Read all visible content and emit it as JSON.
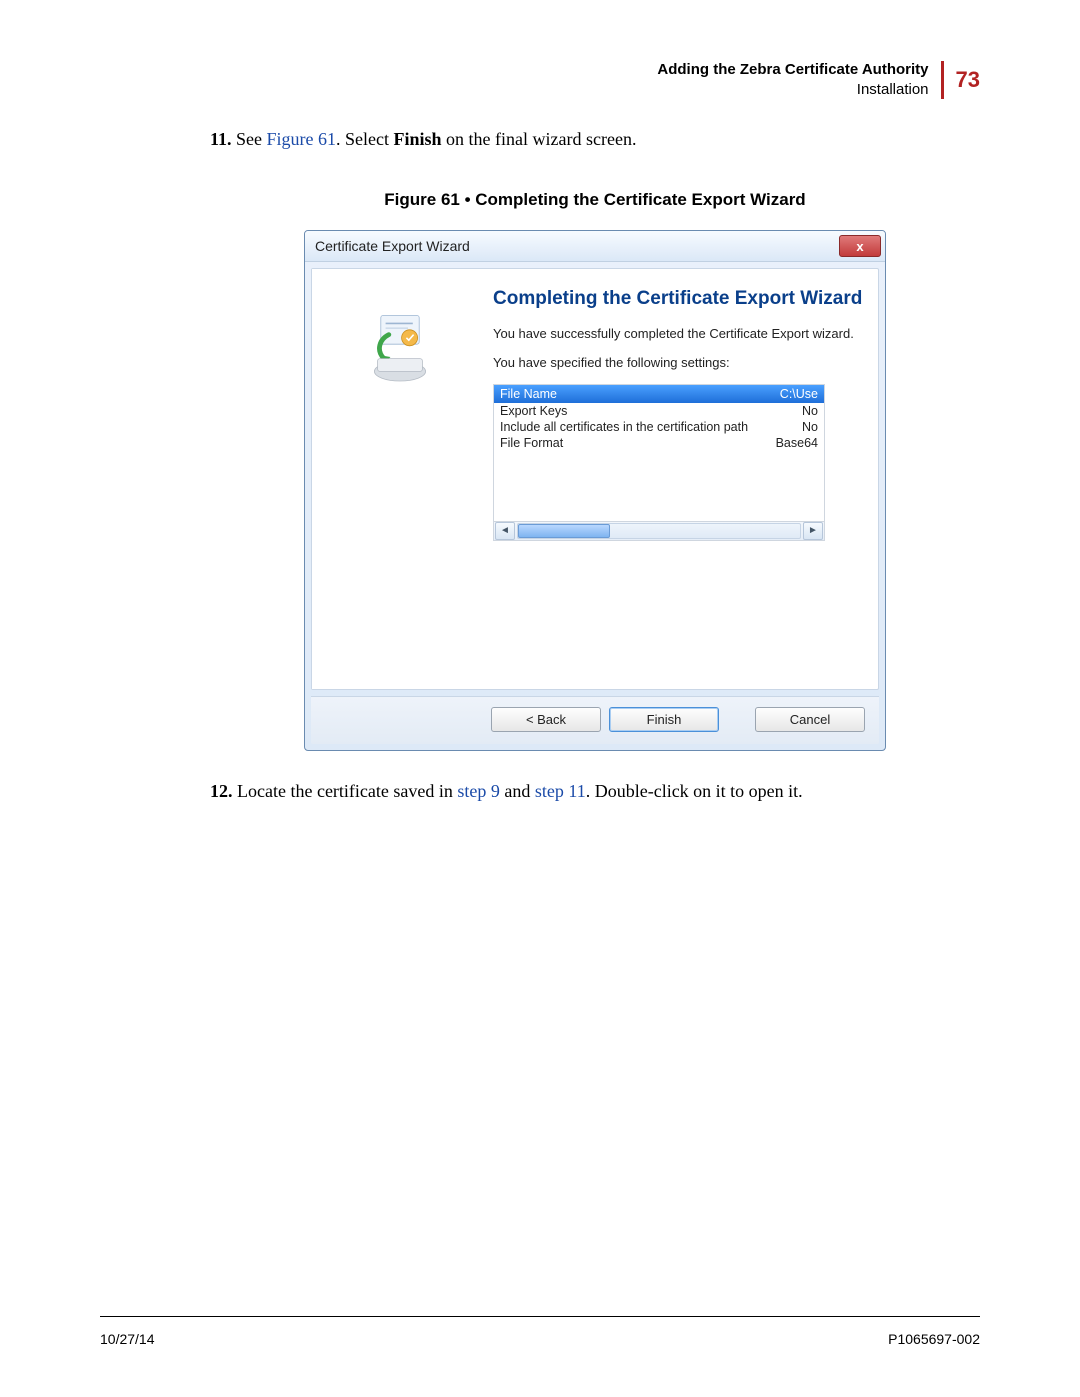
{
  "header": {
    "title": "Adding the Zebra Certificate Authority",
    "subtitle": "Installation",
    "page_number": "73"
  },
  "step11": {
    "num": "11.",
    "pre": " See ",
    "link": "Figure 61",
    "mid": ". Select ",
    "bold": "Finish",
    "post": " on the final wizard screen."
  },
  "figure": {
    "caption": "Figure 61 • Completing the Certificate Export Wizard"
  },
  "wizard": {
    "title": "Certificate Export Wizard",
    "close_label": "x",
    "heading": "Completing the Certificate Export Wizard",
    "desc": "You have successfully completed the Certificate Export wizard.",
    "settings_label": "You have specified the following settings:",
    "header_left": "File Name",
    "header_right": "C:\\Use",
    "rows": [
      {
        "k": "Export Keys",
        "v": "No"
      },
      {
        "k": "Include all certificates in the certification path",
        "v": "No"
      },
      {
        "k": "File Format",
        "v": "Base64"
      }
    ],
    "back": "< Back",
    "finish": "Finish",
    "cancel": "Cancel"
  },
  "step12": {
    "num": "12.",
    "pre": " Locate the certificate saved in ",
    "link1": "step 9",
    "mid": " and ",
    "link2": "step 11",
    "post": ". Double-click on it to open it."
  },
  "footer": {
    "date": "10/27/14",
    "doc": "P1065697-002"
  }
}
